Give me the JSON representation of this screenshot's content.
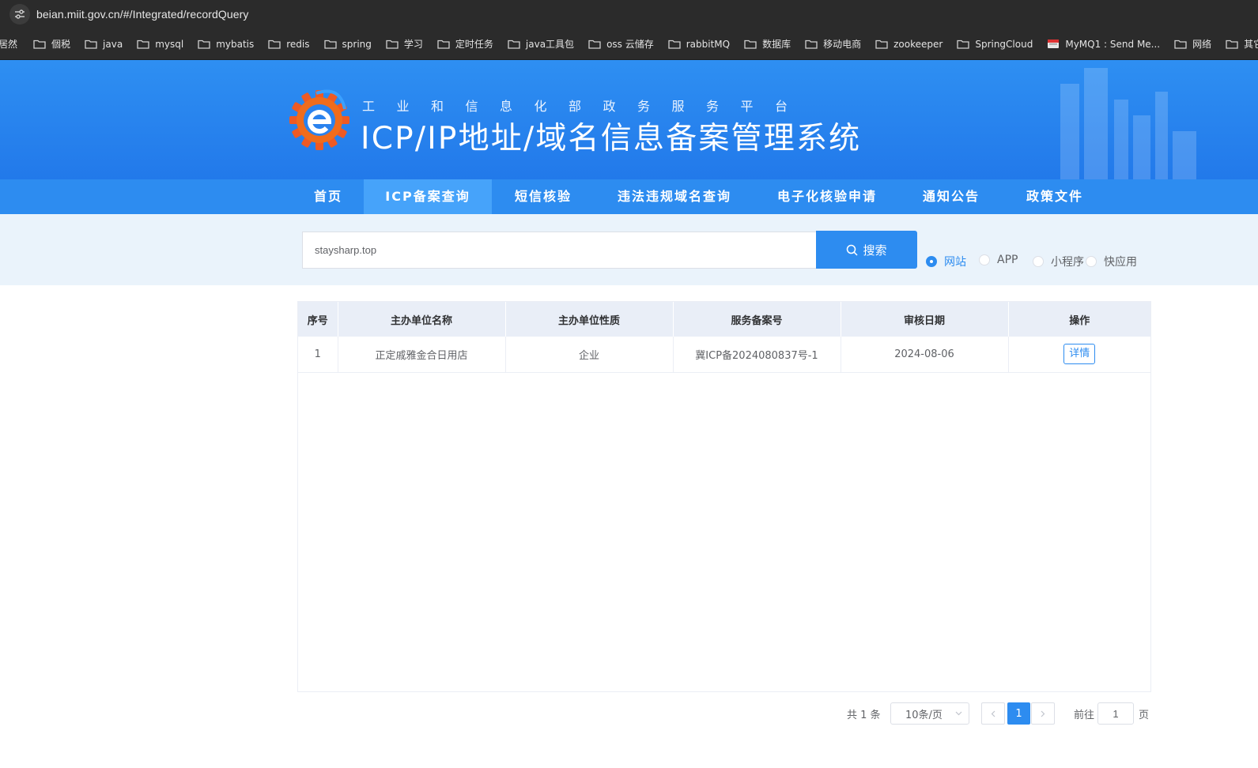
{
  "browser": {
    "url": "beian.miit.gov.cn/#/Integrated/recordQuery",
    "bookmarks": [
      "個税",
      "java",
      "mysql",
      "mybatis",
      "redis",
      "spring",
      "学习",
      "定时任务",
      "java工具包",
      "oss 云储存",
      "rabbitMQ",
      "数据库",
      "移动电商",
      "zookeeper",
      "SpringCloud",
      "MyMQ1 : Send Me...",
      "网络",
      "其它工"
    ],
    "bookmark_first": "居然"
  },
  "header": {
    "subtitle": "工业和信息化部政务服务平台",
    "title": "ICP/IP地址/域名信息备案管理系统",
    "brand_color": "#2d8cf0"
  },
  "nav": {
    "items": [
      "首页",
      "ICP备案查询",
      "短信核验",
      "违法违规域名查询",
      "电子化核验申请",
      "通知公告",
      "政策文件"
    ],
    "active": "ICP备案查询"
  },
  "search": {
    "value": "staysharp.top",
    "button_label": "搜索",
    "types": [
      "网站",
      "APP",
      "小程序",
      "快应用"
    ],
    "selected_type": "网站"
  },
  "table": {
    "columns": [
      "序号",
      "主办单位名称",
      "主办单位性质",
      "服务备案号",
      "审核日期",
      "操作"
    ],
    "rows": [
      {
        "index": "1",
        "name": "正定戚雅金合日用店",
        "nature": "企业",
        "record_no": "冀ICP备2024080837号-1",
        "date": "2024-08-06",
        "action": "详情"
      }
    ]
  },
  "pagination": {
    "total_text": "共 1 条",
    "page_size": "10条/页",
    "current_page": "1",
    "goto_label": "前往",
    "goto_value": "1",
    "page_suffix": "页"
  }
}
